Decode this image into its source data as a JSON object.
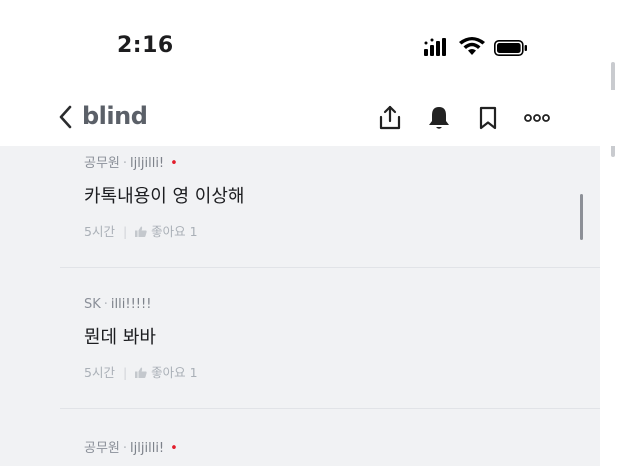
{
  "status": {
    "time": "2:16"
  },
  "nav": {
    "brand": "blind"
  },
  "comments": [
    {
      "company": "공무원",
      "nickname": "ljljilli!",
      "badge": "•",
      "text": "카톡내용이 영 이상해",
      "time": "5시간",
      "like_label": "좋아요 1"
    },
    {
      "company": "SK",
      "nickname": "illi!!!!!",
      "badge": "",
      "text": "뭔데 봐바",
      "time": "5시간",
      "like_label": "좋아요 1"
    },
    {
      "company": "공무원",
      "nickname": "ljljilli!",
      "badge": "•",
      "text": "",
      "time": "",
      "like_label": ""
    }
  ],
  "colors": {
    "accent_badge": "#e21d2b",
    "feed_background": "#f1f2f4"
  },
  "icons": [
    "back-chevron-icon",
    "share-icon",
    "bell-icon",
    "bookmark-icon",
    "more-icon",
    "thumbs-up-icon"
  ]
}
